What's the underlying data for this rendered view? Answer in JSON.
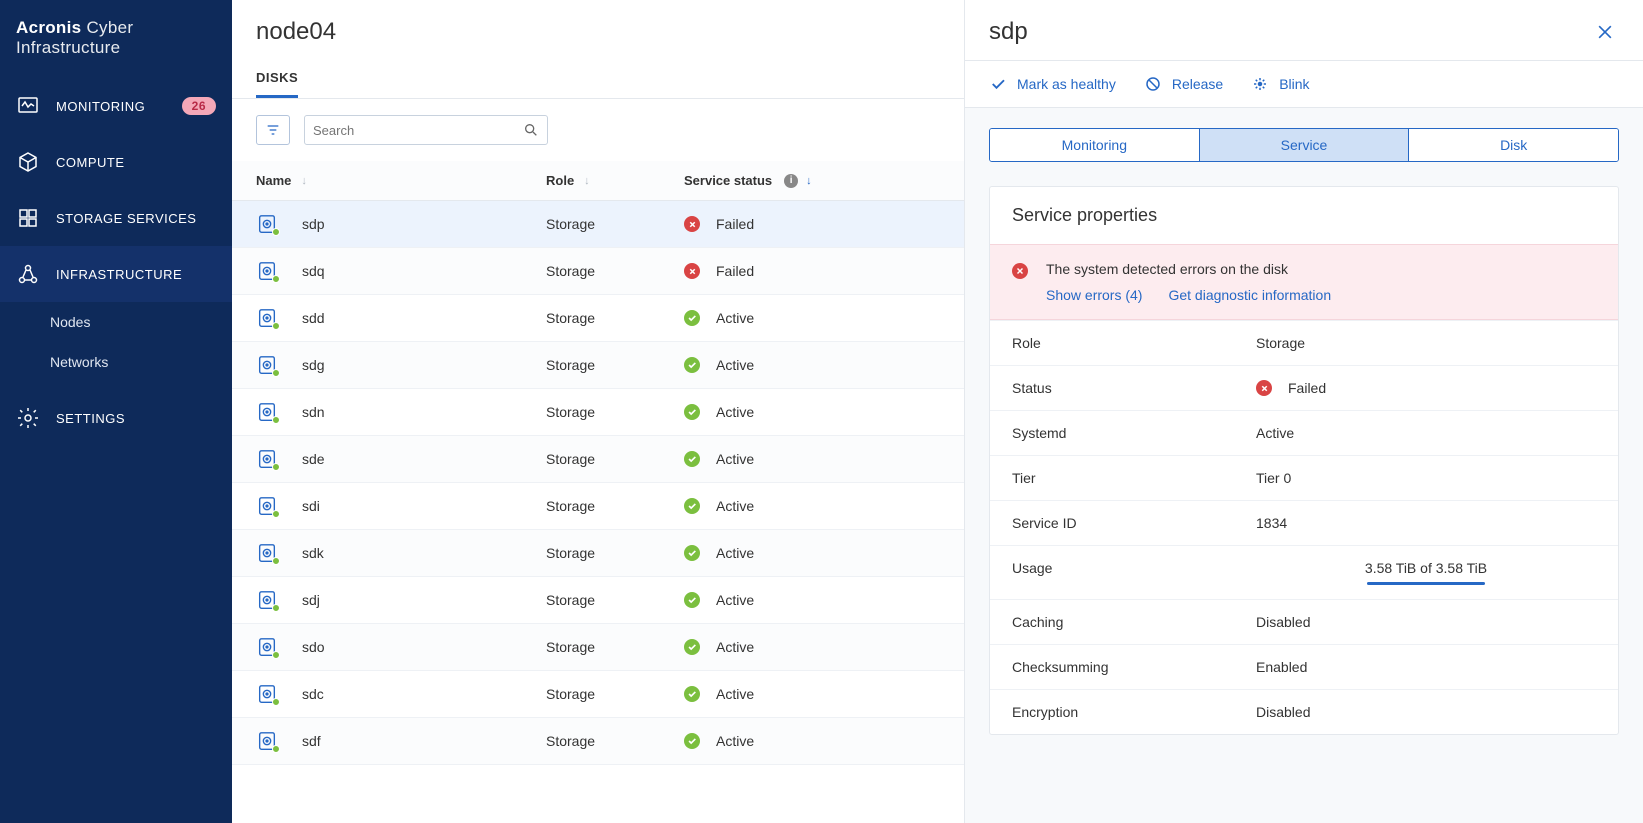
{
  "brand": {
    "strong": "Acronis",
    "rest": "Cyber Infrastructure"
  },
  "nav": {
    "monitoring": "MONITORING",
    "monitoring_badge": "26",
    "compute": "COMPUTE",
    "storage": "STORAGE SERVICES",
    "infrastructure": "INFRASTRUCTURE",
    "nodes": "Nodes",
    "networks": "Networks",
    "settings": "SETTINGS"
  },
  "page": {
    "title": "node04",
    "tab_disks": "DISKS"
  },
  "search": {
    "placeholder": "Search"
  },
  "columns": {
    "name": "Name",
    "role": "Role",
    "status": "Service status"
  },
  "disks": [
    {
      "name": "sdp",
      "role": "Storage",
      "status": "Failed",
      "state": "failed"
    },
    {
      "name": "sdq",
      "role": "Storage",
      "status": "Failed",
      "state": "failed"
    },
    {
      "name": "sdd",
      "role": "Storage",
      "status": "Active",
      "state": "active"
    },
    {
      "name": "sdg",
      "role": "Storage",
      "status": "Active",
      "state": "active"
    },
    {
      "name": "sdn",
      "role": "Storage",
      "status": "Active",
      "state": "active"
    },
    {
      "name": "sde",
      "role": "Storage",
      "status": "Active",
      "state": "active"
    },
    {
      "name": "sdi",
      "role": "Storage",
      "status": "Active",
      "state": "active"
    },
    {
      "name": "sdk",
      "role": "Storage",
      "status": "Active",
      "state": "active"
    },
    {
      "name": "sdj",
      "role": "Storage",
      "status": "Active",
      "state": "active"
    },
    {
      "name": "sdo",
      "role": "Storage",
      "status": "Active",
      "state": "active"
    },
    {
      "name": "sdc",
      "role": "Storage",
      "status": "Active",
      "state": "active"
    },
    {
      "name": "sdf",
      "role": "Storage",
      "status": "Active",
      "state": "active"
    }
  ],
  "detail": {
    "title": "sdp",
    "actions": {
      "mark_healthy": "Mark as healthy",
      "release": "Release",
      "blink": "Blink"
    },
    "tabs": {
      "monitoring": "Monitoring",
      "service": "Service",
      "disk": "Disk"
    },
    "card_title": "Service properties",
    "alert": {
      "text": "The system detected errors on the disk",
      "show_errors": "Show errors (4)",
      "diag": "Get diagnostic information"
    },
    "props": {
      "role_l": "Role",
      "role_v": "Storage",
      "status_l": "Status",
      "status_v": "Failed",
      "systemd_l": "Systemd",
      "systemd_v": "Active",
      "tier_l": "Tier",
      "tier_v": "Tier 0",
      "service_id_l": "Service ID",
      "service_id_v": "1834",
      "usage_l": "Usage",
      "usage_v": "3.58 TiB of 3.58 TiB",
      "usage_pct": 100,
      "caching_l": "Caching",
      "caching_v": "Disabled",
      "checksumming_l": "Checksumming",
      "checksumming_v": "Enabled",
      "encryption_l": "Encryption",
      "encryption_v": "Disabled"
    }
  }
}
